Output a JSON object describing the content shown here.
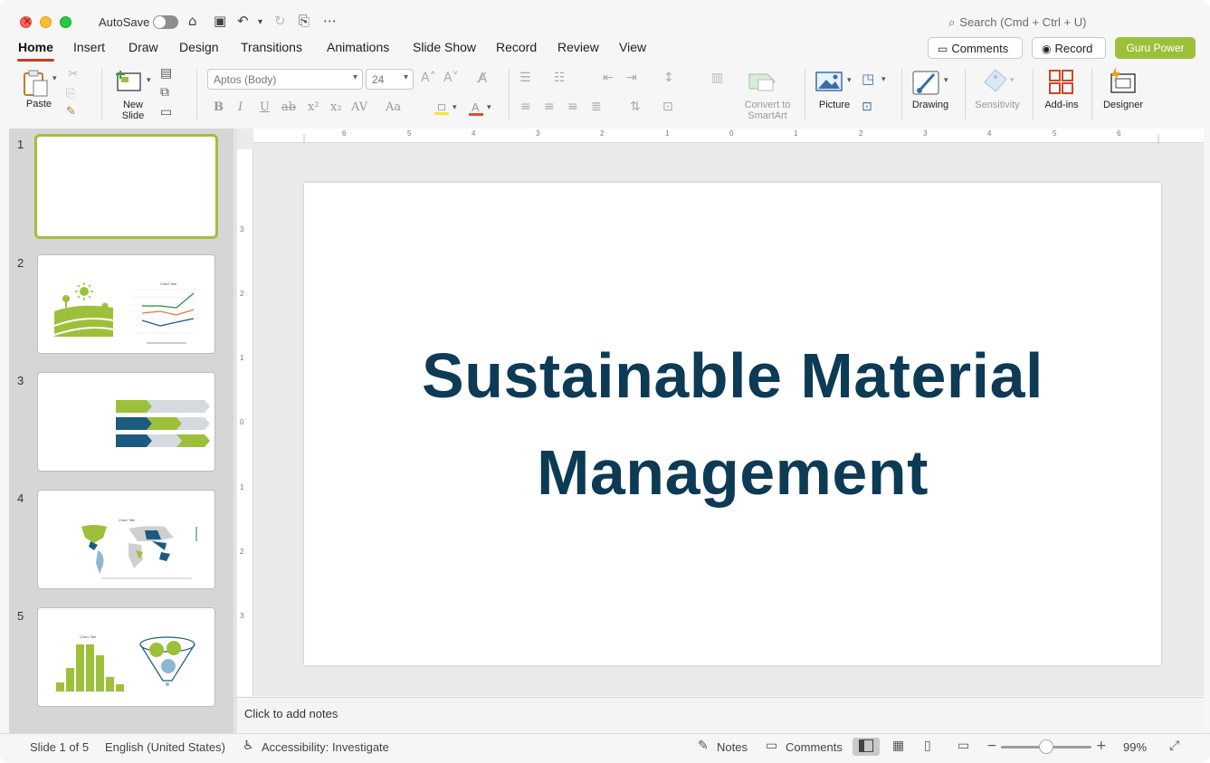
{
  "titlebar": {
    "autosave_label": "AutoSave",
    "search_placeholder": "Search (Cmd + Ctrl + U)",
    "icons": [
      "home-icon",
      "save-icon",
      "undo-icon",
      "redo-icon",
      "save-as-icon",
      "more-icon"
    ]
  },
  "tabs": [
    {
      "label": "Home",
      "active": true
    },
    {
      "label": "Insert"
    },
    {
      "label": "Draw"
    },
    {
      "label": "Design"
    },
    {
      "label": "Transitions"
    },
    {
      "label": "Animations"
    },
    {
      "label": "Slide Show"
    },
    {
      "label": "Record"
    },
    {
      "label": "Review"
    },
    {
      "label": "View"
    }
  ],
  "header_buttons": {
    "comments": "Comments",
    "record": "Record",
    "guru": "Guru Power"
  },
  "ribbon": {
    "paste": "Paste",
    "new_slide_1": "New",
    "new_slide_2": "Slide",
    "font_name": "Aptos (Body)",
    "font_size": "24",
    "convert_1": "Convert to",
    "convert_2": "SmartArt",
    "picture": "Picture",
    "drawing": "Drawing",
    "sensitivity": "Sensitivity",
    "addins": "Add-ins",
    "designer": "Designer",
    "format_buttons": [
      "B",
      "I",
      "U",
      "ab",
      "x²",
      "x₂",
      "AV",
      "Aa"
    ]
  },
  "ruler": {
    "horizontal": [
      "6",
      "5",
      "4",
      "3",
      "2",
      "1",
      "0",
      "1",
      "2",
      "3",
      "4",
      "5",
      "6"
    ],
    "vertical": [
      "3",
      "2",
      "1",
      "0",
      "1",
      "2",
      "3"
    ]
  },
  "thumbnails": [
    {
      "num": "1",
      "selected": true
    },
    {
      "num": "2",
      "chart_title": "Chart Title"
    },
    {
      "num": "3"
    },
    {
      "num": "4",
      "chart_title": "Chart Title"
    },
    {
      "num": "5",
      "chart_title": "Chart Title"
    }
  ],
  "slide": {
    "title_line1": "Sustainable Material",
    "title_line2": "Management",
    "title_color": "#0d3a55"
  },
  "notes": {
    "placeholder": "Click to add notes"
  },
  "status": {
    "slide_info": "Slide 1 of 5",
    "language": "English (United States)",
    "accessibility": "Accessibility: Investigate",
    "notes": "Notes",
    "comments": "Comments",
    "zoom": "99%"
  },
  "colors": {
    "accent_green": "#9dc03b",
    "dark_blue": "#1c5a7f",
    "tab_underline": "#c43e1c"
  }
}
